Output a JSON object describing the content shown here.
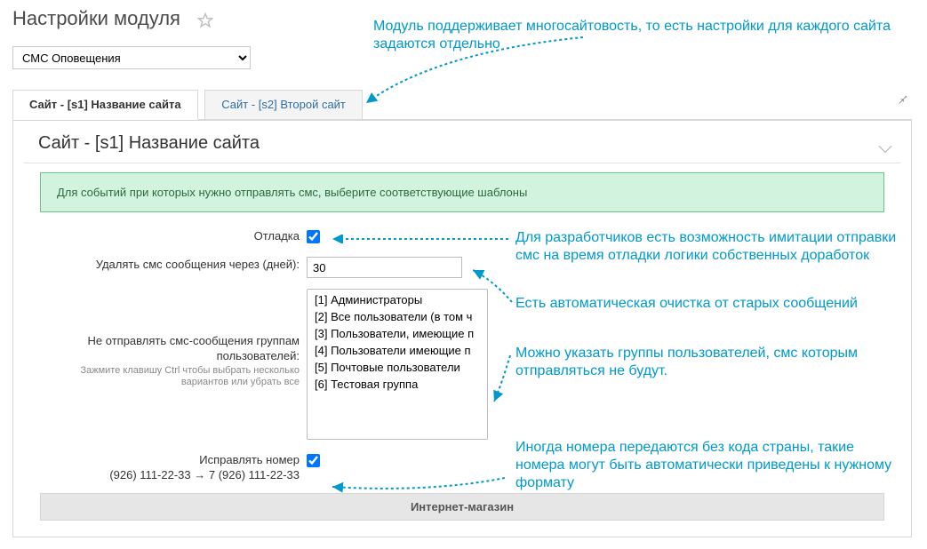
{
  "header": {
    "title": "Настройки модуля",
    "module_selected": "СМС Оповещения"
  },
  "tabs": [
    {
      "label": "Сайт - [s1] Название сайта",
      "active": true
    },
    {
      "label": "Сайт - [s2] Второй сайт",
      "active": false
    }
  ],
  "panel": {
    "title": "Сайт - [s1] Название сайта",
    "notice": "Для событий при которых нужно отправлять смс, выберите соответствующие шаблоны",
    "debug_label": "Отладка",
    "debug_checked": true,
    "delete_days_label": "Удалять смс сообщения через (дней):",
    "delete_days_value": "30",
    "exclude_groups_label": "Не отправлять смс-сообщения группам пользователей:",
    "exclude_groups_hint": "Зажмите клавишу Ctrl чтобы выбрать несколько вариантов или убрать все",
    "groups_options": [
      "[1] Администраторы",
      "[2] Все пользователи (в том ч",
      "[3] Пользователи, имеющие п",
      "[4] Пользователи имеющие п",
      "[5] Почтовые пользователи",
      "[6] Тестовая группа"
    ],
    "fix_number_label": "Исправлять номер",
    "fix_number_example": "(926) 111-22-33 → 7 (926) 111-22-33",
    "fix_number_checked": true,
    "section_bar": "Интернет-магазин"
  },
  "annotations": {
    "multisite": "Модуль поддерживает многосайтовость, то есть настройки для каждого сайта задаются отдельно",
    "debug": "Для разработчиков есть возможность имитации отправки смс на время отладки логики собственных доработок",
    "cleanup": "Есть автоматическая очистка от старых сообщений",
    "groups": "Можно указать группы пользователей, смс которым отправляться не будут.",
    "fix_number": "Иногда номера передаются без кода страны, такие номера могут быть автоматически приведены к нужному формату"
  }
}
